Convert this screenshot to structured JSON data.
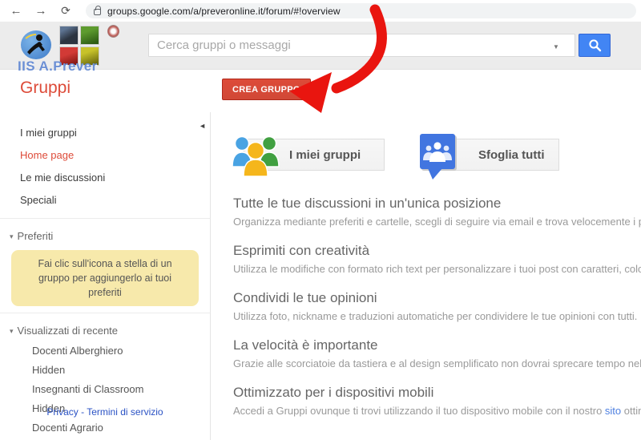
{
  "browser": {
    "url": "groups.google.com/a/preveronline.it/forum/#!overview",
    "back_icon": "←",
    "forward_icon": "→",
    "reload_icon": "⟳"
  },
  "header": {
    "logo_title": "IIS A.Prever",
    "search": {
      "placeholder": "Cerca gruppi o messaggi",
      "caret": "▼"
    }
  },
  "toolbar": {
    "page_title": "Gruppi",
    "create_group_label": "CREA GRUPPO"
  },
  "sidebar": {
    "collapse_icon": "◄",
    "nav": [
      {
        "label": "I miei gruppi"
      },
      {
        "label": "Home page"
      },
      {
        "label": "Le mie discussioni"
      },
      {
        "label": "Speciali"
      }
    ],
    "favorites": {
      "triangle": "▾",
      "label": "Preferiti",
      "tip": "Fai clic sull'icona a stella di un gruppo per aggiungerlo ai tuoi preferiti"
    },
    "recent": {
      "triangle": "▾",
      "label": "Visualizzati di recente",
      "items": [
        {
          "label": "Docenti Alberghiero"
        },
        {
          "label": "Hidden"
        },
        {
          "label": "Insegnanti di Classroom"
        },
        {
          "label": "Hidden"
        },
        {
          "label": "Docenti Agrario"
        }
      ]
    },
    "footer": {
      "privacy": "Privacy",
      "separator": " - ",
      "terms": "Termini di servizio"
    }
  },
  "main": {
    "buttons": [
      {
        "label": "I miei gruppi"
      },
      {
        "label": "Sfoglia tutti"
      }
    ],
    "features": [
      {
        "title": "Tutte le tue discussioni in un'unica posizione",
        "desc": "Organizza mediante preferiti e cartelle, scegli di seguire via email e trova velocemente i post da leggere."
      },
      {
        "title": "Esprimiti con creatività",
        "desc": "Utilizza le modifiche con formato rich text per personalizzare i tuoi post con caratteri, colori e immagini."
      },
      {
        "title": "Condividi le tue opinioni",
        "desc": "Utilizza foto, nickname e traduzioni automatiche per condividere le tue opinioni con tutti."
      },
      {
        "title": "La velocità è importante",
        "desc": "Grazie alle scorciatoie da tastiera e al design semplificato non dovrai sprecare tempo nell'attesa del caricamento."
      },
      {
        "title": "Ottimizzato per i dispositivi mobili",
        "desc_before": "Accedi a Gruppi ovunque ti trovi utilizzando il tuo dispositivo mobile con il nostro ",
        "link": "sito",
        "desc_after": " ottimizzato."
      }
    ]
  },
  "colors": {
    "accent_red": "#dd4b39",
    "search_blue": "#4285f4",
    "arrow_red": "#e9150f",
    "tip_yellow": "#f7e9ab",
    "link_blue": "#2a52c4"
  }
}
